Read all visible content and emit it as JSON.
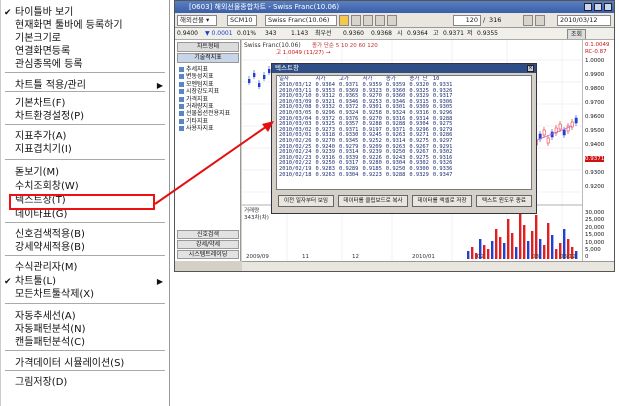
{
  "menu": {
    "items": [
      {
        "label": "타이틀바 보기",
        "checked": true
      },
      {
        "label": "현재화면 툴바에 등록하기"
      },
      {
        "label": "기본크기로"
      },
      {
        "label": "연결화면등록"
      },
      {
        "label": "관심종목에 등록"
      },
      {
        "label": "차트틀 적용/관리",
        "submenu": true
      },
      {
        "label": "기본차트(F)"
      },
      {
        "label": "차트환경설정(P)"
      },
      {
        "label": "지표추가(A)"
      },
      {
        "label": "지표겹치기(I)"
      },
      {
        "label": "돋보기(M)"
      },
      {
        "label": "수치조회창(W)"
      },
      {
        "label": "텍스트창(T)"
      },
      {
        "label": "데이타표(G)"
      },
      {
        "label": "신호검색적용(B)"
      },
      {
        "label": "강세약세적용(B)"
      },
      {
        "label": "수식관리자(M)"
      },
      {
        "label": "차트툴(L)",
        "checked": true,
        "submenu": true
      },
      {
        "label": "모든차트툴삭제(X)"
      },
      {
        "label": "자동추세선(A)"
      },
      {
        "label": "자동패턴분석(N)"
      },
      {
        "label": "캔들패턴분석(C)"
      },
      {
        "label": "가격데이터 시뮬레이션(S)"
      },
      {
        "label": "그림저장(D)"
      }
    ]
  },
  "window": {
    "title": "[0603] 해외선물종합차트 - Swiss Franc(10.06)",
    "symbol_code": "SCM10",
    "symbol_name": "Swiss Franc(10.06)",
    "period_count": "120",
    "period_total": "316",
    "date": "2010/03/12",
    "quote_strip": [
      "0.9400",
      "▼ 0.0001",
      "0.01%",
      "343",
      "1.143",
      "최우선",
      "0.9360",
      "0.9368",
      "시",
      "0.9364",
      "고",
      "0.9371",
      "저",
      "0.9355"
    ],
    "buttons": [
      "조회",
      "분",
      "주",
      "월",
      "틱"
    ],
    "chart_caption": "Swiss Franc(10.06)",
    "chart_tag": "종가 단순 5 10 20 60 120",
    "chart_hint": "고 1.0049 (11/27) →",
    "volume_label": "거래량",
    "volume_value": "343차(차)",
    "x_labels": [
      "2009/09",
      "11",
      "12",
      "2010/01",
      "02",
      "03",
      "03/12"
    ]
  },
  "left_panel": {
    "header": "차트형태",
    "tab": "기술적지표",
    "items": [
      "추세지표",
      "변동성지표",
      "모멘텀지표",
      "시장강도지표",
      "가격지표",
      "거래량지표",
      "선물옵션전용지표",
      "기타지표",
      "사용자지표"
    ],
    "bottom_buttons": [
      "신호검색",
      "강세/약세",
      "시스템트레이딩"
    ]
  },
  "yaxis": {
    "top": [
      "0.1.0049",
      "RC-0.87"
    ],
    "ticks": [
      "1.0000",
      "0.9900",
      "0.9800",
      "0.9700",
      "0.9600",
      "0.9500",
      "0.9400",
      "0.9371",
      "0.9300",
      "0.9200"
    ],
    "vol_ticks": [
      "30,000",
      "25,000",
      "20,000",
      "15,000",
      "10,000",
      "5,000",
      "0"
    ]
  },
  "dialog": {
    "title": "텍스트창",
    "close": "×",
    "columns": [
      "일자",
      "시가",
      "고가",
      "저가",
      "종가",
      "종가 단",
      "10"
    ],
    "rows": [
      [
        "2010/03/12",
        "0.9364",
        "0.9371",
        "0.9359",
        "0.9359",
        "0.9320",
        "0.9331"
      ],
      [
        "2010/03/11",
        "0.9353",
        "0.9369",
        "0.9323",
        "0.9360",
        "0.9325",
        "0.9326"
      ],
      [
        "2010/03/10",
        "0.9312",
        "0.9365",
        "0.9270",
        "0.9360",
        "0.9329",
        "0.9317"
      ],
      [
        "2010/03/09",
        "0.9321",
        "0.9346",
        "0.9253",
        "0.9346",
        "0.9315",
        "0.9306"
      ],
      [
        "2010/03/08",
        "0.9332",
        "0.9372",
        "0.9301",
        "0.9301",
        "0.9309",
        "0.9305"
      ],
      [
        "2010/03/05",
        "0.9296",
        "0.9324",
        "0.9258",
        "0.9324",
        "0.9316",
        "0.9296"
      ],
      [
        "2010/03/04",
        "0.9372",
        "0.9376",
        "0.9270",
        "0.9316",
        "0.9314",
        "0.9288"
      ],
      [
        "2010/03/03",
        "0.9325",
        "0.9357",
        "0.9288",
        "0.9288",
        "0.9304",
        "0.9275"
      ],
      [
        "2010/03/02",
        "0.9273",
        "0.9371",
        "0.9197",
        "0.9371",
        "0.9296",
        "0.9279"
      ],
      [
        "2010/03/01",
        "0.9318",
        "0.9330",
        "0.9245",
        "0.9263",
        "0.9271",
        "0.9286"
      ],
      [
        "2010/02/26",
        "0.9270",
        "0.9345",
        "0.9252",
        "0.9314",
        "0.9275",
        "0.9297"
      ],
      [
        "2010/02/25",
        "0.9240",
        "0.9279",
        "0.9209",
        "0.9263",
        "0.9267",
        "0.9291"
      ],
      [
        "2010/02/24",
        "0.9239",
        "0.9314",
        "0.9239",
        "0.9250",
        "0.9267",
        "0.9302"
      ],
      [
        "2010/02/23",
        "0.9316",
        "0.9339",
        "0.9226",
        "0.9243",
        "0.9275",
        "0.9316"
      ],
      [
        "2010/02/22",
        "0.9250",
        "0.9317",
        "0.9280",
        "0.9304",
        "0.9302",
        "0.9326"
      ],
      [
        "2010/02/19",
        "0.9283",
        "0.9289",
        "0.9185",
        "0.9250",
        "0.9300",
        "0.9336"
      ],
      [
        "2010/02/18",
        "0.9263",
        "0.9304",
        "0.9223",
        "0.9288",
        "0.9329",
        "0.9347"
      ]
    ],
    "buttons": [
      "이전 일자부터 보임",
      "데이터를 클립보드로 복사",
      "데이터를 엑셀로 저장",
      "텍스트 윈도우 종료"
    ]
  },
  "colors": {
    "highlight": "#e11111",
    "title_bar": "#3a5ea8",
    "candle_up": "#e02020",
    "candle_down": "#2040d0",
    "ma": "#d060d0"
  }
}
